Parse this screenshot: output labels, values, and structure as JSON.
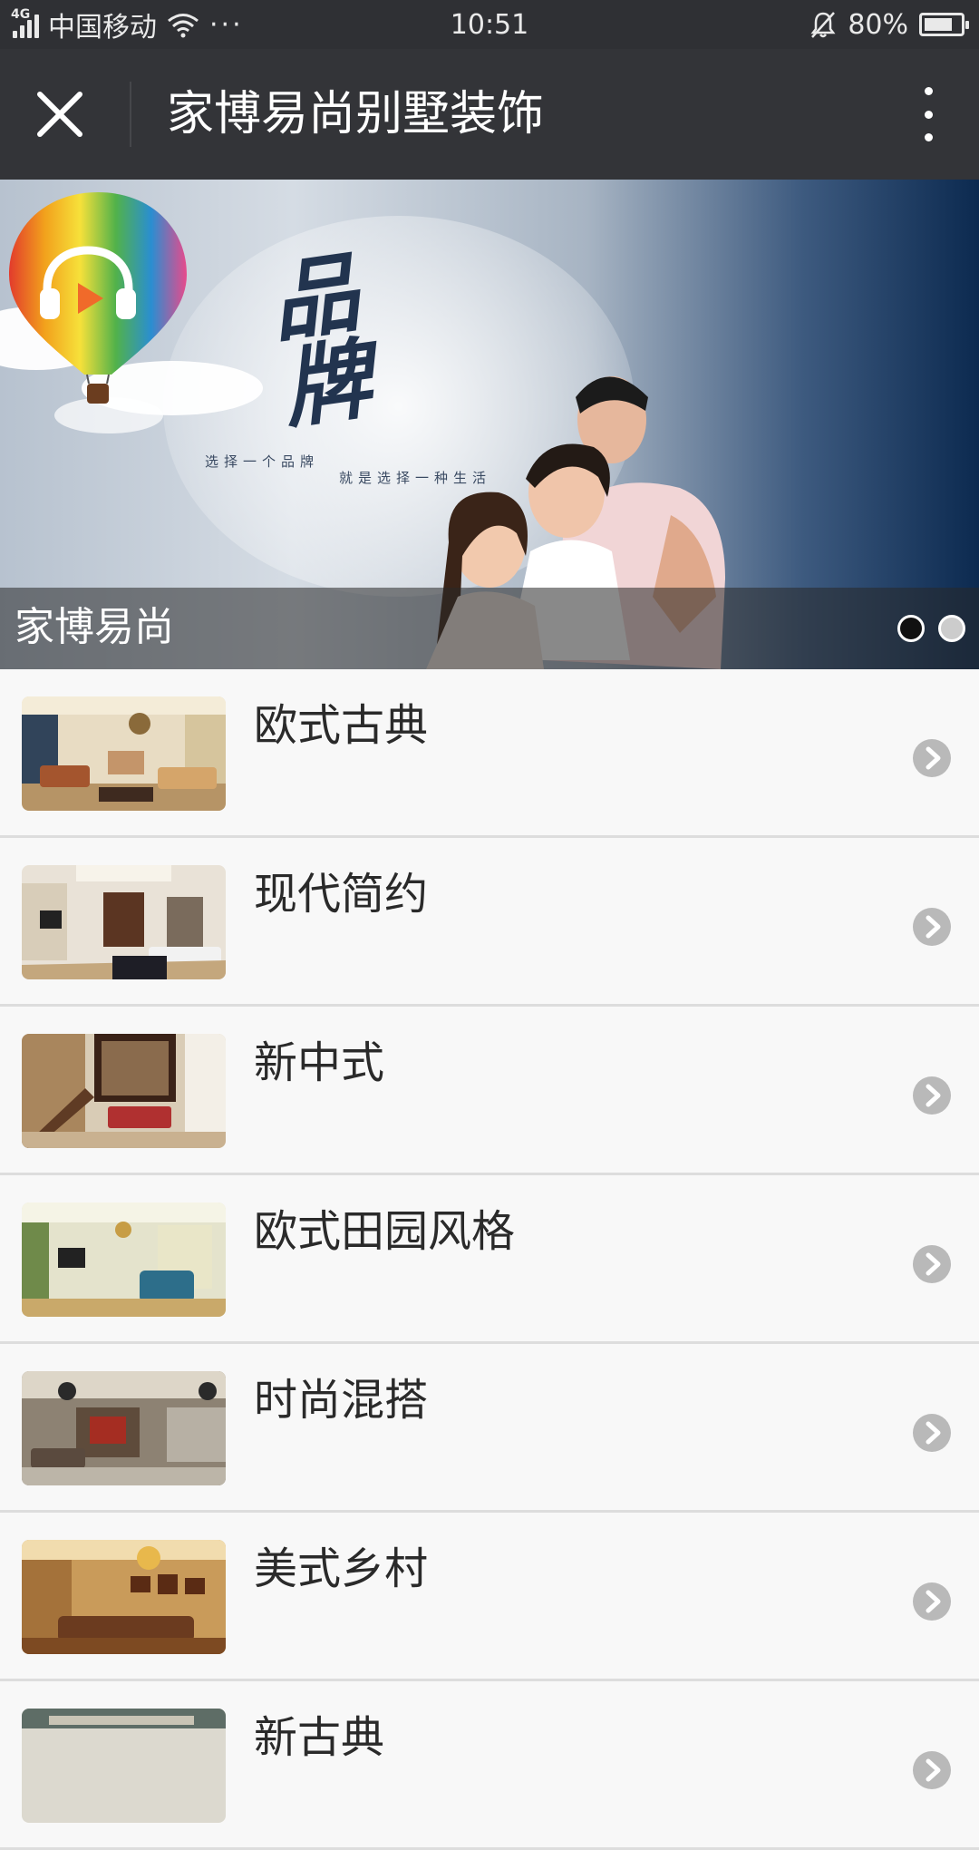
{
  "status_bar": {
    "network": "4G",
    "carrier": "中国移动",
    "more": "···",
    "time": "10:51",
    "battery": "80%",
    "battery_level": 0.8
  },
  "header": {
    "title": "家博易尚别墅装饰"
  },
  "banner": {
    "brand": "品牌",
    "slogan_1": "选择一个品牌",
    "slogan_2": "就是选择一种生活",
    "caption": "家博易尚",
    "slides": 2,
    "active_slide": 1
  },
  "styles": [
    {
      "label": "欧式古典"
    },
    {
      "label": "现代简约"
    },
    {
      "label": "新中式"
    },
    {
      "label": "欧式田园风格"
    },
    {
      "label": "时尚混搭"
    },
    {
      "label": "美式乡村"
    },
    {
      "label": "新古典"
    }
  ],
  "colors": {
    "status_bar": "#2f3034",
    "title_bar": "#333438",
    "list_bg": "#f8f8f8",
    "divider": "#dddddd",
    "chevron": "#b9b9b9"
  }
}
